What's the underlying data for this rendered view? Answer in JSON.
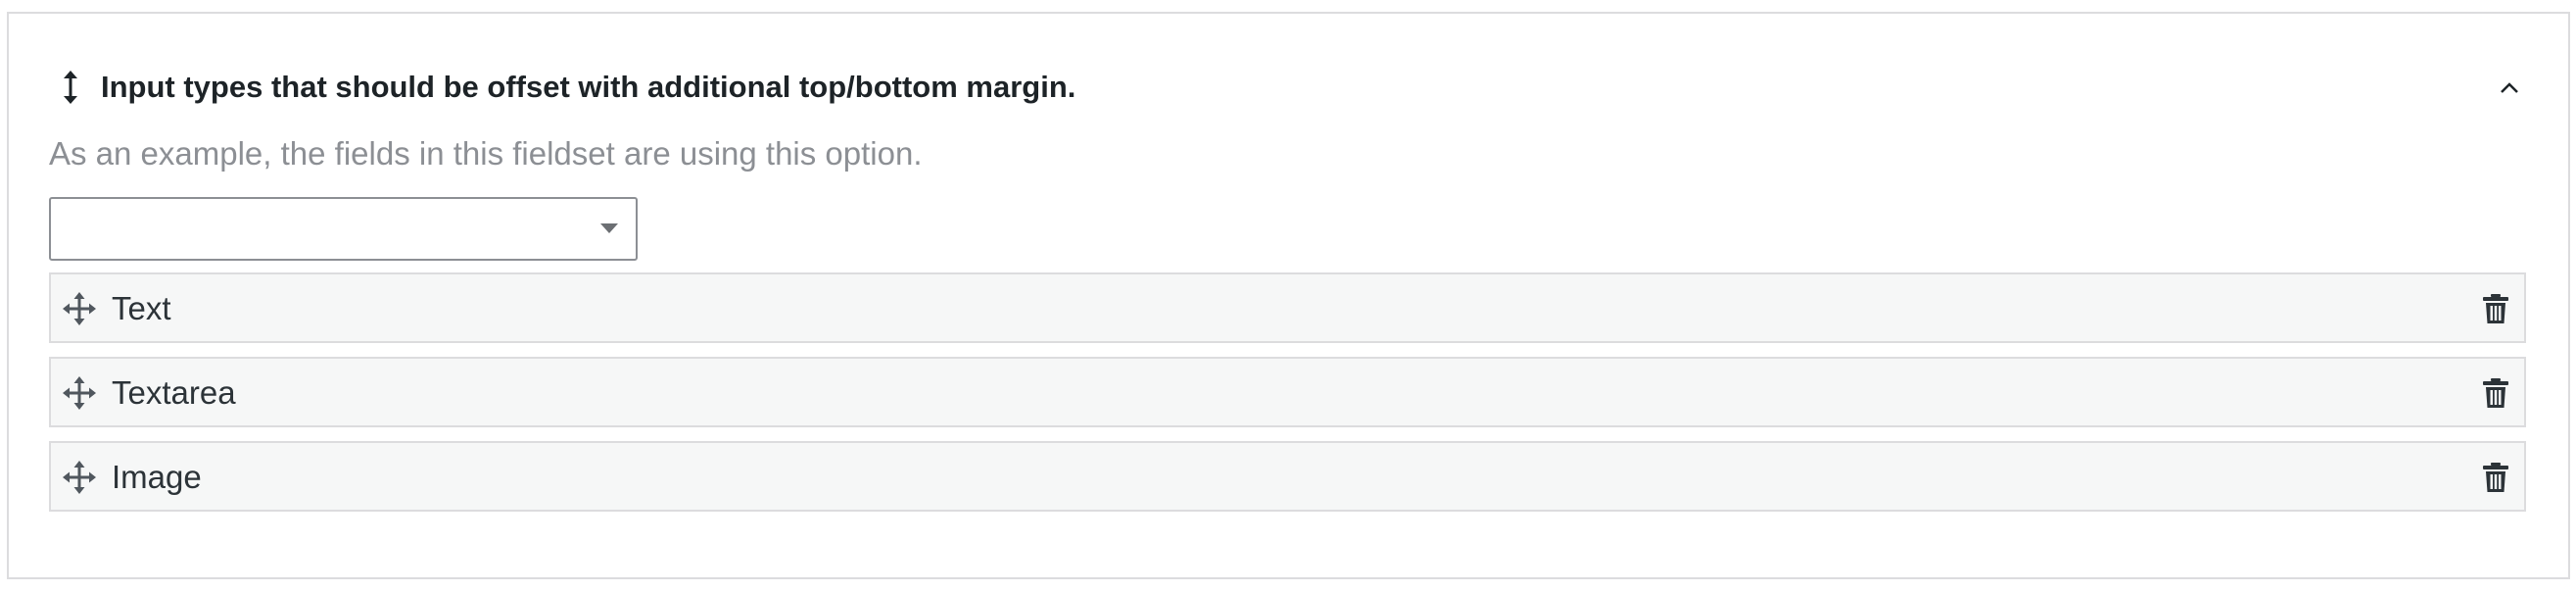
{
  "fieldset": {
    "title": "Input types that should be offset with additional top/bottom margin.",
    "title_icon": "vertical-resize-arrow-icon",
    "toggle_icon": "chevron-up-icon",
    "description": "As an example, the fields in this fieldset are using this option."
  },
  "select": {
    "value": "",
    "caret_icon": "caret-down-icon"
  },
  "items": [
    {
      "label": "Text",
      "drag_icon": "move-icon",
      "delete_icon": "trash-icon"
    },
    {
      "label": "Textarea",
      "drag_icon": "move-icon",
      "delete_icon": "trash-icon"
    },
    {
      "label": "Image",
      "drag_icon": "move-icon",
      "delete_icon": "trash-icon"
    }
  ],
  "colors": {
    "border": "#dcdcde",
    "row_background": "#f6f7f7",
    "muted_text": "#8c8f94",
    "text": "#2c3338"
  }
}
